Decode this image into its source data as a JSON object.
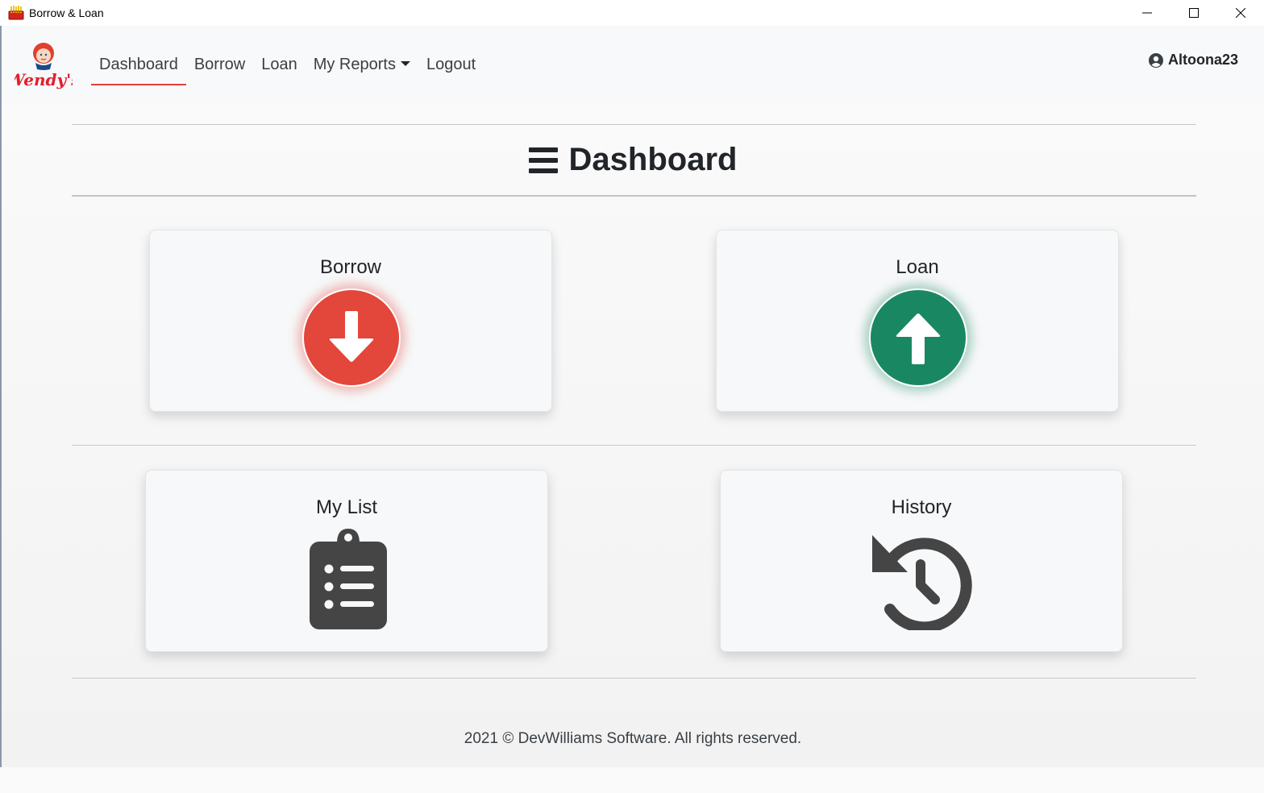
{
  "window": {
    "title": "Borrow & Loan",
    "controls": [
      "minimize-icon",
      "maximize-icon",
      "close-icon"
    ]
  },
  "navbar": {
    "brand": "Wendy's",
    "links": [
      {
        "label": "Dashboard",
        "active": true
      },
      {
        "label": "Borrow",
        "active": false
      },
      {
        "label": "Loan",
        "active": false
      },
      {
        "label": "My Reports",
        "active": false,
        "dropdown": true
      },
      {
        "label": "Logout",
        "active": false
      }
    ],
    "user": {
      "icon": "user-circle-icon",
      "name": "Altoona23"
    }
  },
  "page": {
    "title": "Dashboard",
    "title_icon": "bars-icon"
  },
  "cards": [
    {
      "title": "Borrow",
      "icon": "arrow-down-icon",
      "color": "#e3463a"
    },
    {
      "title": "Loan",
      "icon": "arrow-up-icon",
      "color": "#198862"
    },
    {
      "title": "My List",
      "icon": "clipboard-list-icon",
      "color": "#454545"
    },
    {
      "title": "History",
      "icon": "history-icon",
      "color": "#454545"
    }
  ],
  "footer": {
    "text": "2021 © DevWilliams Software. All rights reserved."
  }
}
